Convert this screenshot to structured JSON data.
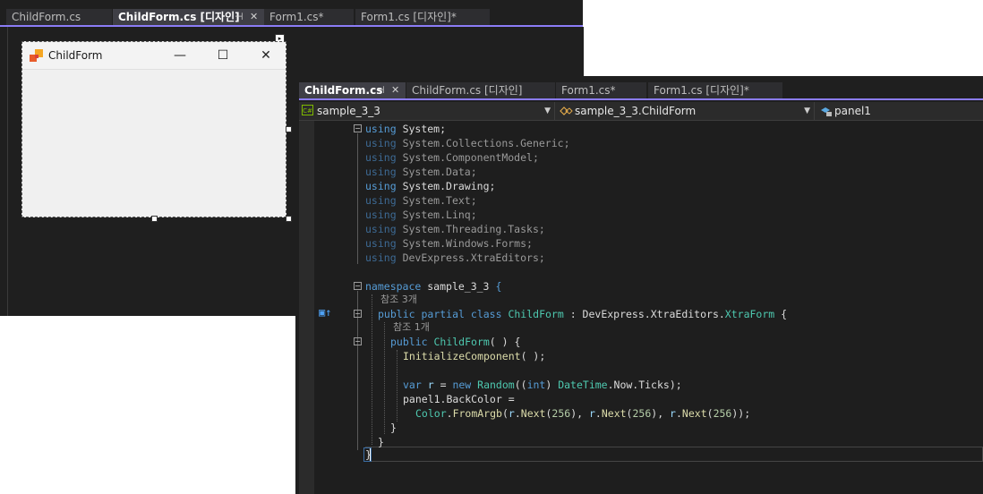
{
  "back_window": {
    "tabs": [
      {
        "label": "ChildForm.cs"
      },
      {
        "label": "ChildForm.cs [디자인]"
      },
      {
        "label": "Form1.cs*"
      },
      {
        "label": "Form1.cs [디자인]*"
      }
    ],
    "tab_pin": "⊣",
    "tab_close": "✕",
    "form": {
      "title": "ChildForm",
      "minimize": "—",
      "maximize": "☐",
      "close": "✕",
      "smart_tag": "▸"
    }
  },
  "front_window": {
    "tabs": [
      {
        "label": "ChildForm.cs"
      },
      {
        "label": "ChildForm.cs [디자인]"
      },
      {
        "label": "Form1.cs*"
      },
      {
        "label": "Form1.cs [디자인]*"
      }
    ],
    "tab_pin": "⊣",
    "tab_close": "✕",
    "nav": {
      "project": "sample_3_3",
      "class": "sample_3_3.ChildForm",
      "member": "panel1",
      "project_icon": "C#"
    },
    "code": {
      "usings": [
        {
          "kw": "using",
          "ns": "System;"
        },
        {
          "kw": "using",
          "ns": "System.Collections.Generic;"
        },
        {
          "kw": "using",
          "ns": "System.ComponentModel;"
        },
        {
          "kw": "using",
          "ns": "System.Data;"
        },
        {
          "kw": "using",
          "ns": "System.Drawing;"
        },
        {
          "kw": "using",
          "ns": "System.Text;"
        },
        {
          "kw": "using",
          "ns": "System.Linq;"
        },
        {
          "kw": "using",
          "ns": "System.Threading.Tasks;"
        },
        {
          "kw": "using",
          "ns": "System.Windows.Forms;"
        },
        {
          "kw": "using",
          "ns": "DevExpress.XtraEditors;"
        }
      ],
      "namespace_kw": "namespace",
      "namespace_name": "sample_3_3",
      "open_brace": "{",
      "close_brace": "}",
      "refs_class": "참조 3개",
      "class_public": "public",
      "class_partial": "partial",
      "class_kw": "class",
      "class_name": "ChildForm",
      "class_colon": " : ",
      "base_ns": "DevExpress.XtraEditors.",
      "base_type": "XtraForm",
      "refs_ctor": "참조 1개",
      "ctor_public": "public",
      "ctor_name": "ChildForm",
      "ctor_parens": "( ) {",
      "init_call": "InitializeComponent",
      "init_tail": "( );",
      "var_kw": "var",
      "var_name": "r",
      "eq": " = ",
      "new_kw": "new",
      "random_type": "Random",
      "int_kw": "int",
      "datetime_type": "DateTime",
      "ticks": ".Now.Ticks);",
      "backcolor_line": "panel1.BackColor =",
      "color_type": "Color",
      "from_argb": "FromArgb",
      "next_call": "Next",
      "num_256": "256"
    }
  }
}
